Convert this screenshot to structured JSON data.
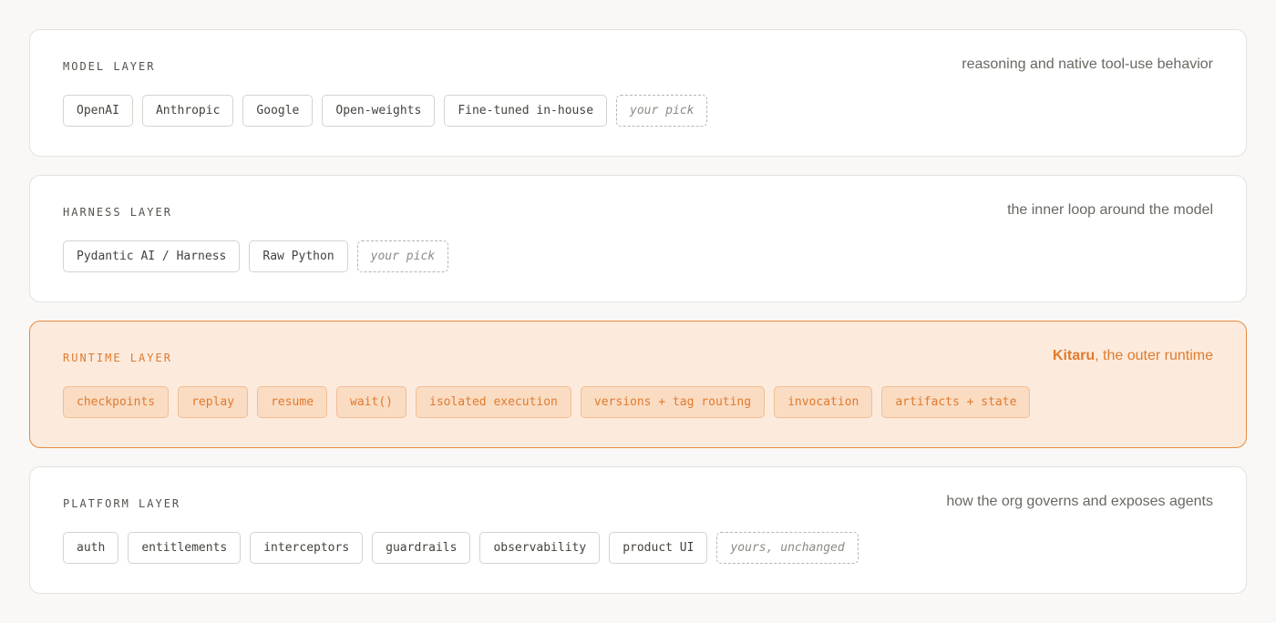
{
  "layers": {
    "model": {
      "title": "MODEL LAYER",
      "description": "reasoning and native tool-use behavior",
      "chips": [
        "OpenAI",
        "Anthropic",
        "Google",
        "Open-weights",
        "Fine-tuned in-house"
      ],
      "pick": "your pick"
    },
    "harness": {
      "title": "HARNESS LAYER",
      "description": "the inner loop around the model",
      "chips": [
        "Pydantic AI / Harness",
        "Raw Python"
      ],
      "pick": "your pick"
    },
    "runtime": {
      "title": "RUNTIME LAYER",
      "description_brand": "Kitaru",
      "description_rest": ", the outer runtime",
      "chips": [
        "checkpoints",
        "replay",
        "resume",
        "wait()",
        "isolated execution",
        "versions + tag routing",
        "invocation",
        "artifacts + state"
      ]
    },
    "platform": {
      "title": "PLATFORM LAYER",
      "description": "how the org governs and exposes agents",
      "chips": [
        "auth",
        "entitlements",
        "interceptors",
        "guardrails",
        "observability",
        "product UI"
      ],
      "pick": "yours, unchanged"
    }
  },
  "colors": {
    "accent": "#e07a2e",
    "runtime_background": "#fcebdd",
    "runtime_border": "#e8893f",
    "card_background": "#ffffff",
    "page_background": "#f9f8f6"
  }
}
